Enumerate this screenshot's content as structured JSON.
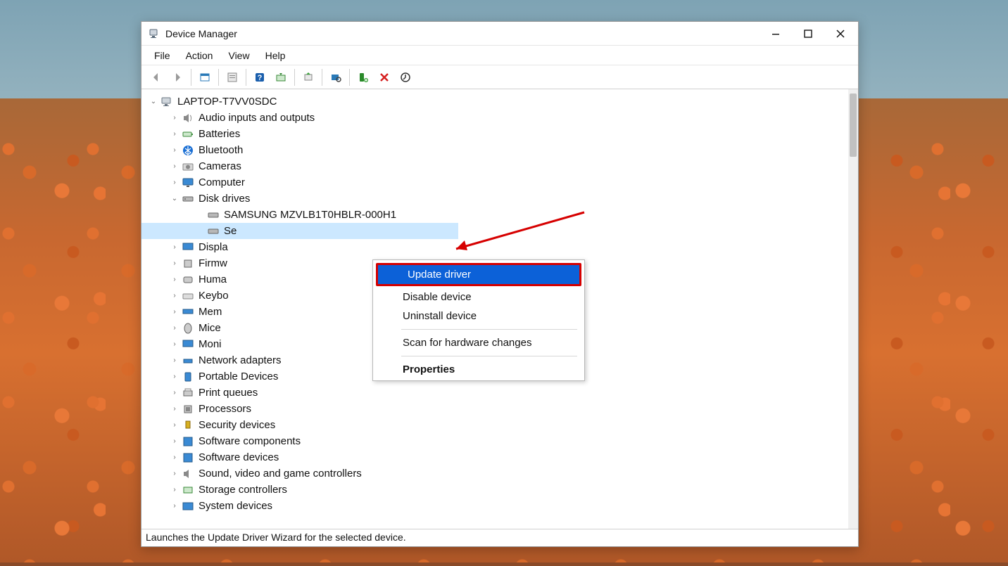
{
  "window": {
    "title": "Device Manager"
  },
  "menubar": {
    "file": "File",
    "action": "Action",
    "view": "View",
    "help": "Help"
  },
  "toolbar": {
    "back": "back-icon",
    "forward": "forward-icon",
    "show_hidden": "show-hidden-icon",
    "properties": "properties-icon",
    "help": "help-icon",
    "computer": "computer-actions-icon",
    "update": "update-driver-icon",
    "scan": "scan-hardware-icon",
    "add": "add-legacy-icon",
    "remove": "uninstall-icon",
    "refresh": "refresh-icon"
  },
  "tree": {
    "root": "LAPTOP-T7VV0SDC",
    "categories": [
      {
        "label": "Audio inputs and outputs"
      },
      {
        "label": "Batteries"
      },
      {
        "label": "Bluetooth"
      },
      {
        "label": "Cameras"
      },
      {
        "label": "Computer"
      },
      {
        "label": "Disk drives",
        "expanded": true,
        "children": [
          {
            "label": "SAMSUNG MZVLB1T0HBLR-000H1"
          },
          {
            "label": "Se",
            "selected": true
          }
        ]
      },
      {
        "label": "Displa"
      },
      {
        "label": "Firmw"
      },
      {
        "label": "Huma"
      },
      {
        "label": "Keybo"
      },
      {
        "label": "Mem"
      },
      {
        "label": "Mice "
      },
      {
        "label": "Moni"
      },
      {
        "label": "Network adapters"
      },
      {
        "label": "Portable Devices"
      },
      {
        "label": "Print queues"
      },
      {
        "label": "Processors"
      },
      {
        "label": "Security devices"
      },
      {
        "label": "Software components"
      },
      {
        "label": "Software devices"
      },
      {
        "label": "Sound, video and game controllers"
      },
      {
        "label": "Storage controllers"
      },
      {
        "label": "System devices"
      }
    ]
  },
  "context_menu": {
    "update_driver": "Update driver",
    "disable_device": "Disable device",
    "uninstall_device": "Uninstall device",
    "scan_hardware": "Scan for hardware changes",
    "properties": "Properties"
  },
  "statusbar": {
    "text": "Launches the Update Driver Wizard for the selected device."
  }
}
